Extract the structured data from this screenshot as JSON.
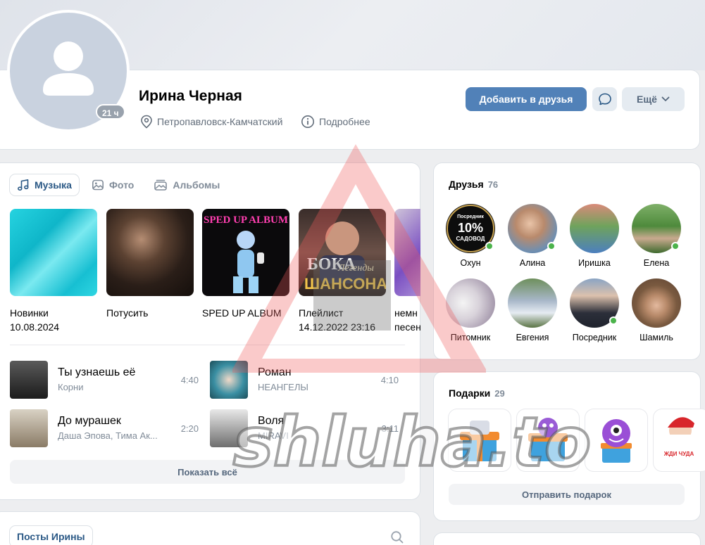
{
  "profile": {
    "name": "Ирина Черная",
    "online_badge": "21 ч",
    "location": "Петропавловск-Камчатский",
    "details_link": "Подробнее",
    "add_friend_label": "Добавить в друзья",
    "more_label": "Ещё"
  },
  "music": {
    "tabs": [
      {
        "label": "Музыка",
        "icon": "music-note-icon"
      },
      {
        "label": "Фото",
        "icon": "photo-icon"
      },
      {
        "label": "Альбомы",
        "icon": "albums-icon"
      }
    ],
    "albums": [
      {
        "line1": "Новинки",
        "line2": "10.08.2024"
      },
      {
        "line1": "Потусить",
        "line2": ""
      },
      {
        "line1": "SPED UP ALBUM",
        "line2": ""
      },
      {
        "line1": "Плейлист",
        "line2": "14.12.2022 23:16"
      },
      {
        "line1": "немн",
        "line2": "песен"
      }
    ],
    "album_cover_texts": {
      "sped_up": "SPED UP ALBUM",
      "boka_1": "БОКА",
      "boka_2": "ШАНСОНА",
      "boka_script": "Легенды"
    },
    "tracks": [
      {
        "title": "Ты узнаешь её",
        "artist": "Корни",
        "duration": "4:40"
      },
      {
        "title": "Роман",
        "artist": "НЕАНГЕЛЫ",
        "duration": "4:10"
      },
      {
        "title": "До мурашек",
        "artist": "Даша Эпова, Тима Ак...",
        "duration": "2:20"
      },
      {
        "title": "Воля",
        "artist": "MIRAVI",
        "duration": "3:11"
      }
    ],
    "show_all_label": "Показать всё"
  },
  "posts": {
    "tab_label": "Посты Ирины"
  },
  "friends": {
    "title": "Друзья",
    "count": "76",
    "items": [
      {
        "name": "Охун",
        "online": true
      },
      {
        "name": "Алина",
        "online": true
      },
      {
        "name": "Иришка",
        "online": false
      },
      {
        "name": "Елена",
        "online": true
      },
      {
        "name": "Питомник",
        "online": false
      },
      {
        "name": "Евгения",
        "online": false
      },
      {
        "name": "Посредник",
        "online": true
      },
      {
        "name": "Шамиль",
        "online": false
      }
    ],
    "okhun_avatar_texts": {
      "top": "Посредник",
      "big": "10%",
      "bottom": "САДОВОД"
    }
  },
  "gifts": {
    "title": "Подарки",
    "count": "29",
    "send_label": "Отправить подарок",
    "gift_text": "ЖДИ ЧУДА"
  },
  "watermark": {
    "text": "shluha.to"
  },
  "colors": {
    "primary_button": "#5181b8",
    "link": "#2a5885",
    "online": "#4bb34b",
    "secondary_text": "#818c99"
  }
}
